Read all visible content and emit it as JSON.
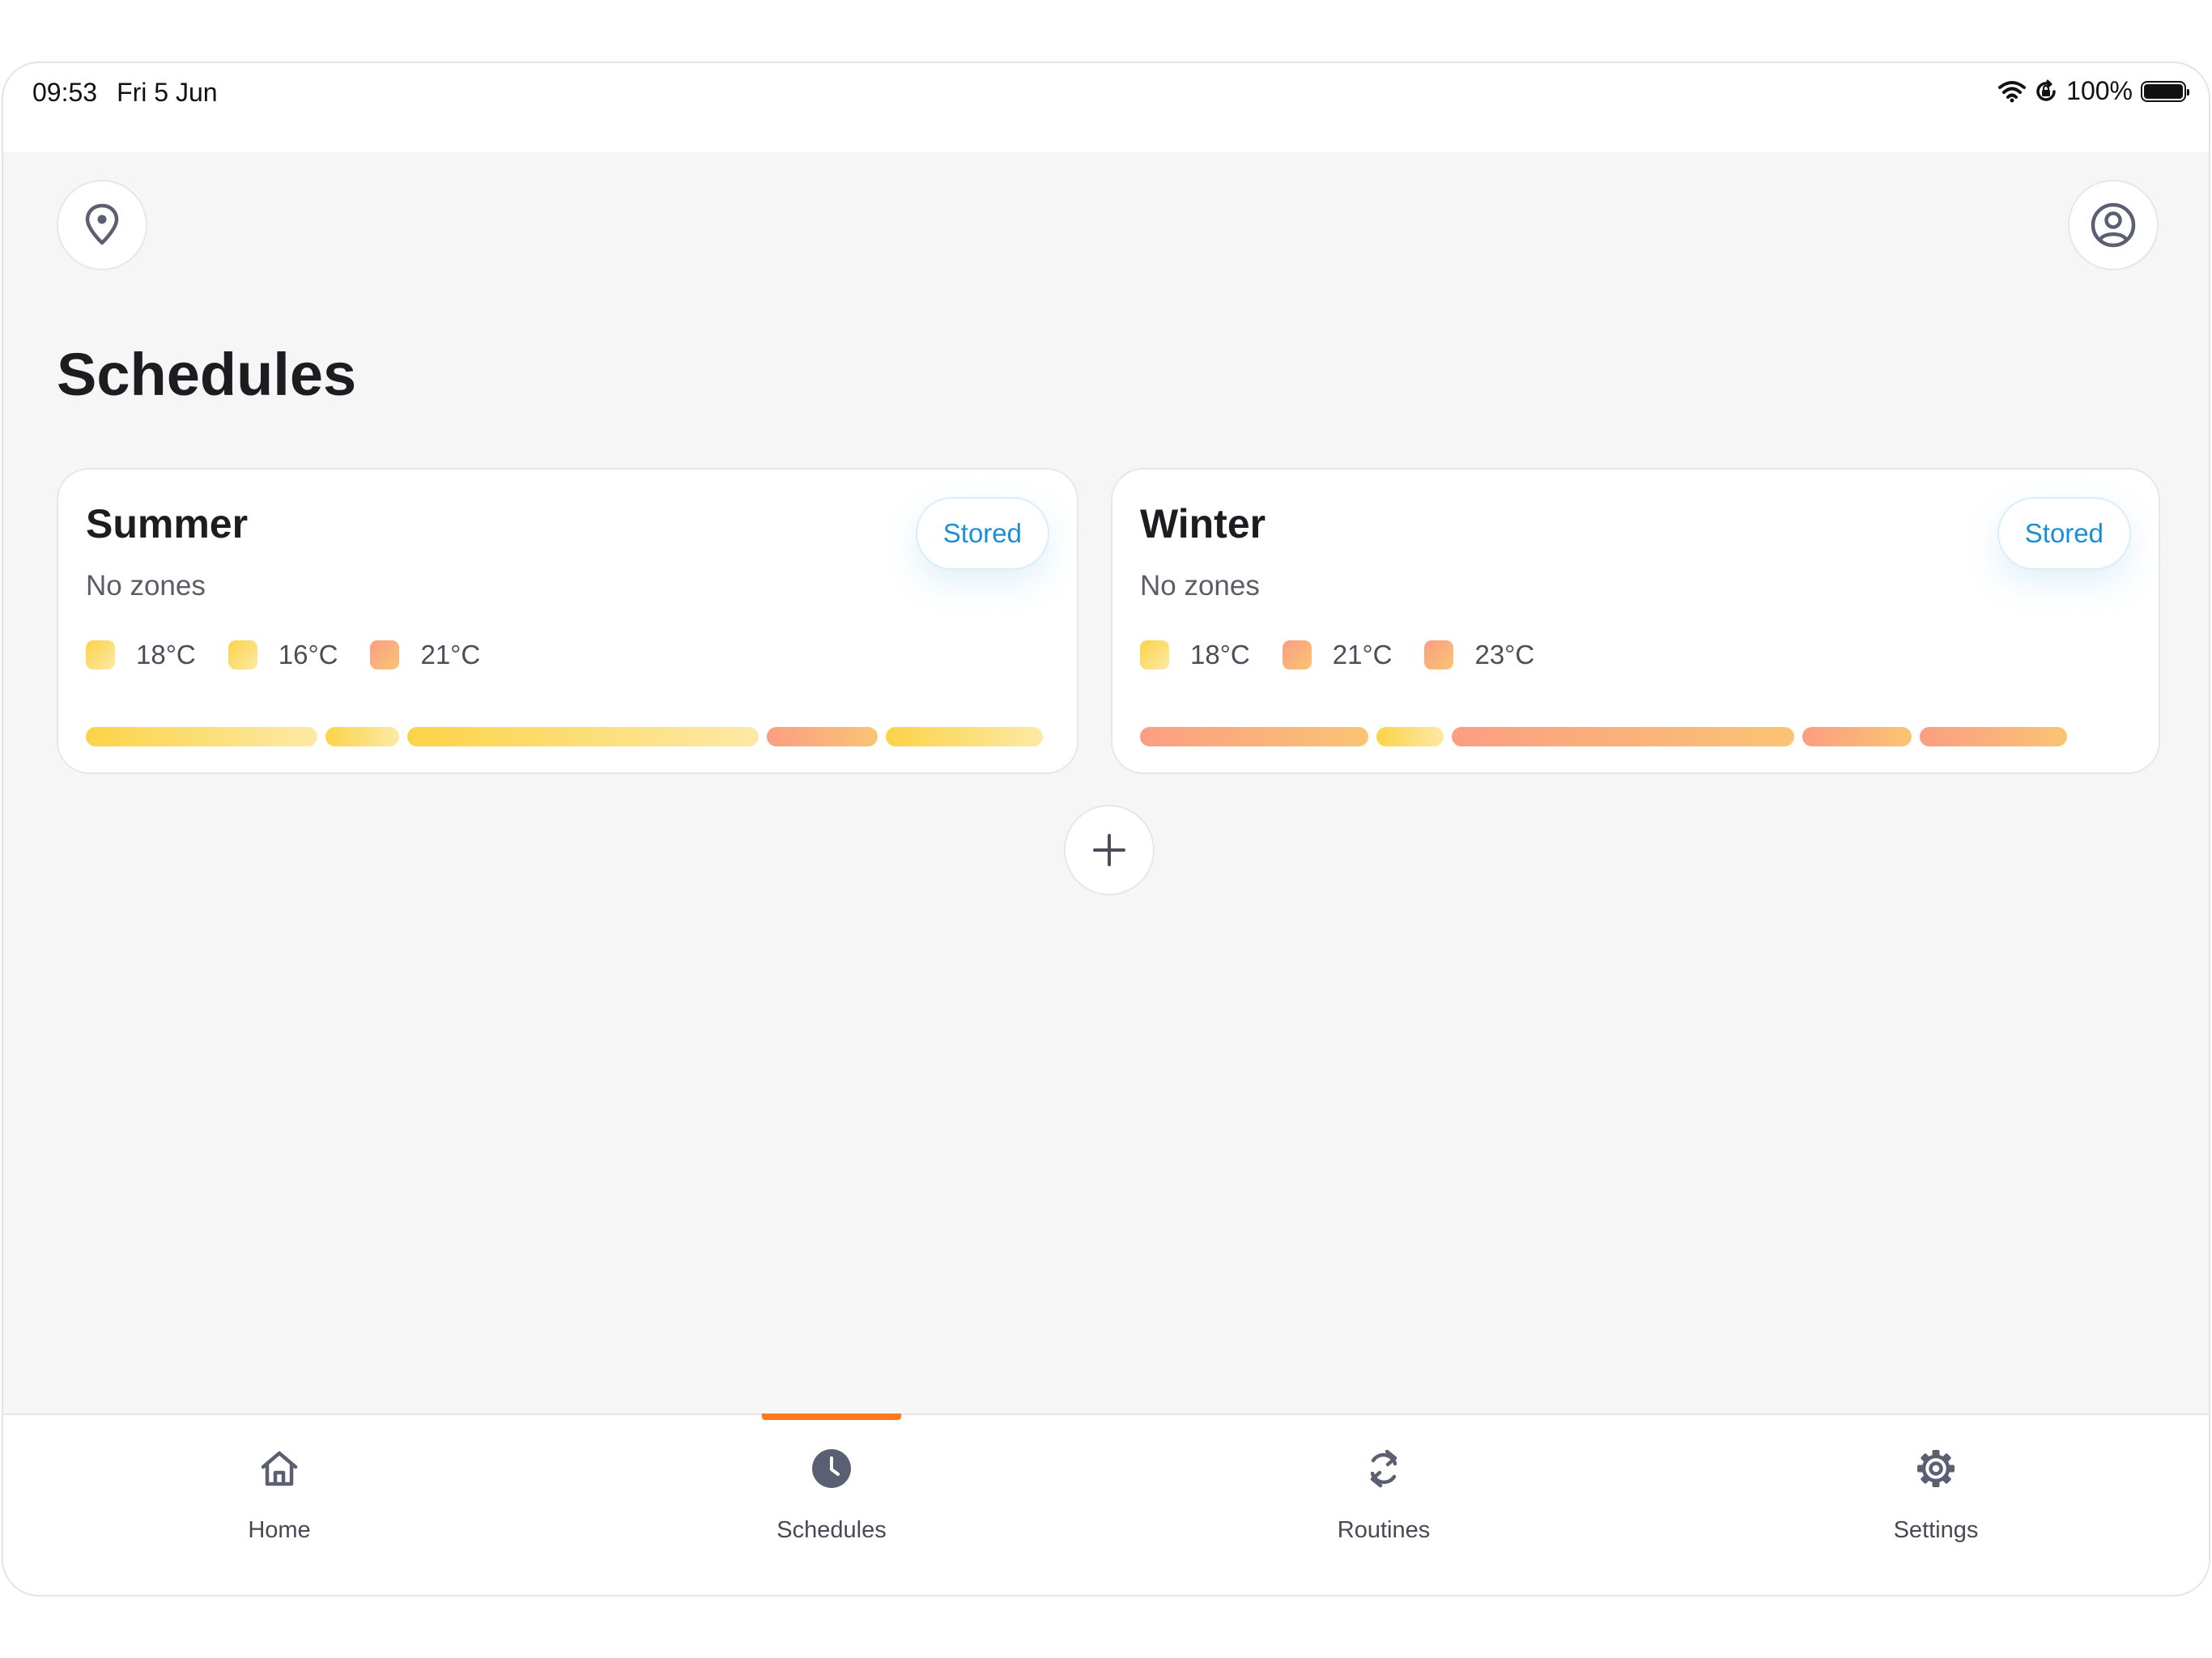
{
  "status_bar": {
    "time": "09:53",
    "date": "Fri 5 Jun",
    "battery": "100%"
  },
  "header": {
    "location_icon": "map-pin-icon",
    "profile_icon": "user-circle-icon"
  },
  "page": {
    "title": "Schedules"
  },
  "colors": {
    "yellow": "#fbd34d",
    "orange": "#fa9f76",
    "accent": "#ff7a1a",
    "link": "#1a8fd6"
  },
  "schedules": [
    {
      "name": "Summer",
      "subtitle": "No zones",
      "status": "Stored",
      "legend": [
        {
          "label": "18°C",
          "color": "yellow"
        },
        {
          "label": "16°C",
          "color": "yellow"
        },
        {
          "label": "21°C",
          "color": "orange"
        }
      ],
      "timeline": [
        {
          "color": "yellow",
          "share": 0.25
        },
        {
          "color": "yellow",
          "share": 0.08
        },
        {
          "color": "yellow",
          "share": 0.38
        },
        {
          "color": "orange",
          "share": 0.12
        },
        {
          "color": "yellow",
          "share": 0.17
        }
      ]
    },
    {
      "name": "Winter",
      "subtitle": "No zones",
      "status": "Stored",
      "legend": [
        {
          "label": "18°C",
          "color": "yellow"
        },
        {
          "label": "21°C",
          "color": "orange"
        },
        {
          "label": "23°C",
          "color": "orange"
        }
      ],
      "timeline": [
        {
          "color": "orange",
          "share": 0.24
        },
        {
          "color": "yellow",
          "share": 0.07
        },
        {
          "color": "orange",
          "share": 0.36
        },
        {
          "color": "orange",
          "share": 0.115
        },
        {
          "color": "orange",
          "share": 0.155
        }
      ]
    }
  ],
  "add_button": {
    "icon": "plus-icon"
  },
  "tabs": [
    {
      "label": "Home",
      "icon": "home-icon",
      "active": false
    },
    {
      "label": "Schedules",
      "icon": "clock-icon",
      "active": true
    },
    {
      "label": "Routines",
      "icon": "refresh-icon",
      "active": false
    },
    {
      "label": "Settings",
      "icon": "gear-icon",
      "active": false
    }
  ]
}
